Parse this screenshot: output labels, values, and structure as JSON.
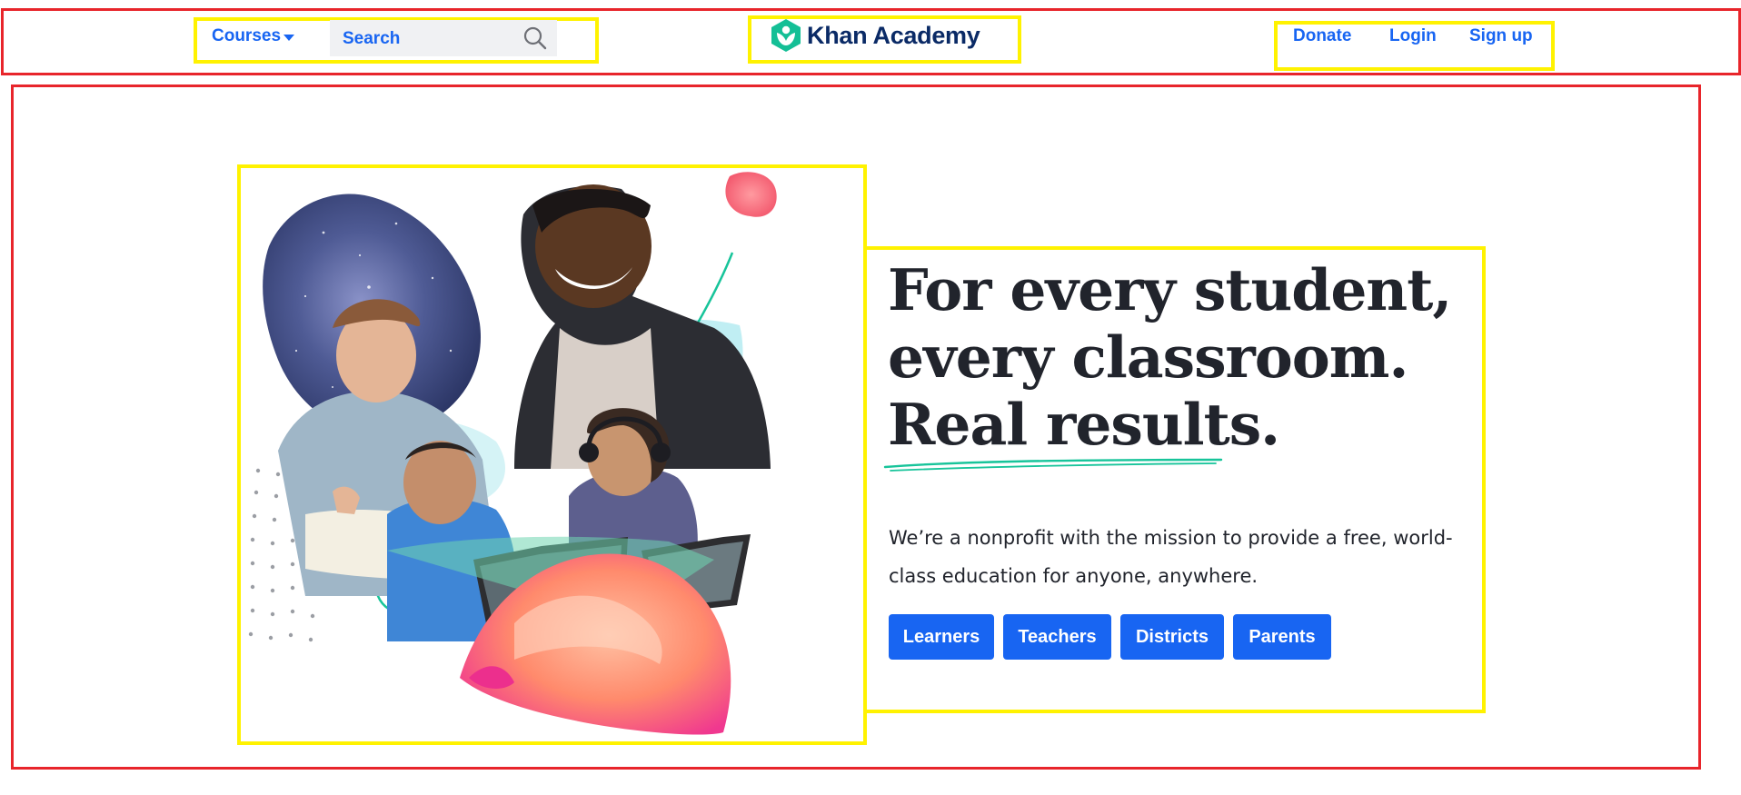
{
  "header": {
    "courses_label": "Courses",
    "search_placeholder": "Search",
    "logo_text": "Khan Academy",
    "donate_label": "Donate",
    "login_label": "Login",
    "signup_label": "Sign up"
  },
  "hero": {
    "headline_line1": "For every student,",
    "headline_line2": "every classroom.",
    "headline_line3": "Real results.",
    "tagline": "We’re a nonprofit with the mission to provide a free, world-class education for anyone, anywhere.",
    "buttons": [
      {
        "label": "Learners"
      },
      {
        "label": "Teachers"
      },
      {
        "label": "Districts"
      },
      {
        "label": "Parents"
      }
    ]
  },
  "colors": {
    "brand_blue": "#1865f2",
    "logo_green": "#14bf96",
    "logo_navy": "#0a2a66",
    "annotation_red": "#e8252b",
    "annotation_yellow": "#fff200"
  }
}
